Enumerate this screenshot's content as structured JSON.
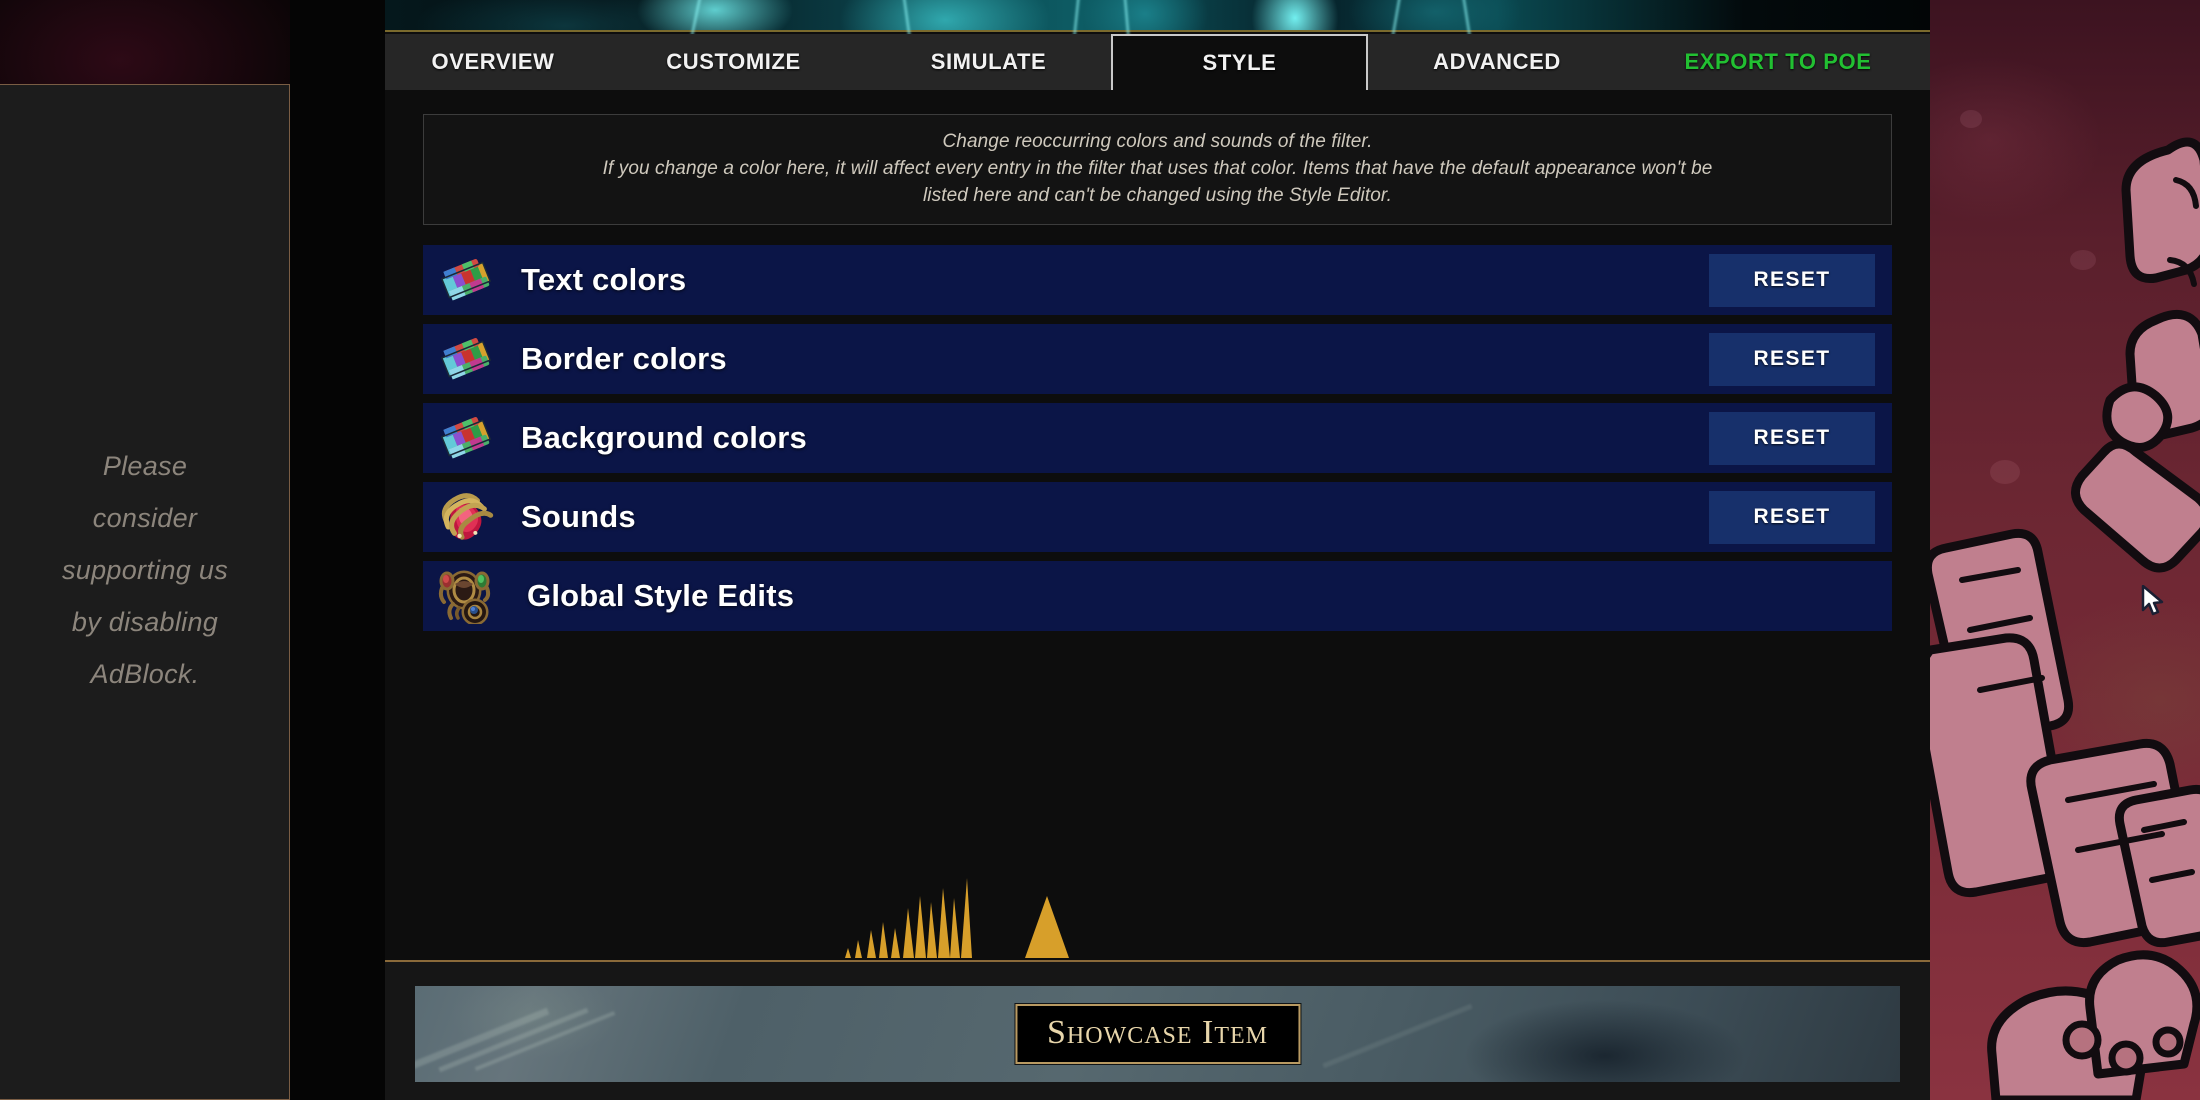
{
  "app": {
    "banner_alt": "filter-banner-art"
  },
  "tabs": [
    {
      "id": "overview",
      "label": "OVERVIEW",
      "active": false
    },
    {
      "id": "customize",
      "label": "CUSTOMIZE",
      "active": false
    },
    {
      "id": "simulate",
      "label": "SIMULATE",
      "active": false
    },
    {
      "id": "style",
      "label": "STYLE",
      "active": true
    },
    {
      "id": "advanced",
      "label": "ADVANCED",
      "active": false
    },
    {
      "id": "export",
      "label": "EXPORT TO POE",
      "active": false
    }
  ],
  "info": {
    "line1": "Change reoccurring colors and sounds of the filter.",
    "line2": "If you change a color here, it will affect every entry in the filter that uses that color. Items that have the default appearance won't be",
    "line3": "listed here and can't be changed using the Style Editor."
  },
  "style_rows": [
    {
      "id": "text-colors",
      "label": "Text colors",
      "icon": "chromatic-orb-icon",
      "reset_label": "RESET",
      "has_reset": true
    },
    {
      "id": "border-colors",
      "label": "Border colors",
      "icon": "chromatic-orb-icon",
      "reset_label": "RESET",
      "has_reset": true
    },
    {
      "id": "background-colors",
      "label": "Background colors",
      "icon": "chromatic-orb-icon",
      "reset_label": "RESET",
      "has_reset": true
    },
    {
      "id": "sounds",
      "label": "Sounds",
      "icon": "ruby-ring-icon",
      "reset_label": "RESET",
      "has_reset": true
    },
    {
      "id": "global-style-edits",
      "label": "Global Style Edits",
      "icon": "gemmed-amulet-icon",
      "reset_label": "",
      "has_reset": false
    }
  ],
  "showcase": {
    "item_label": "Showcase Item"
  },
  "adblock": {
    "line1": "Please",
    "line2": "consider",
    "line3": "supporting us",
    "line4": "by disabling",
    "line5": "AdBlock."
  },
  "colors": {
    "row_background": "#0b1547",
    "reset_button": "#17306b",
    "export_tab_text": "#22c032",
    "panel_background": "#0d0d0d",
    "tabbar_background": "#262626",
    "gold_border": "#8a6a3a",
    "showcase_text": "#e8d6ab"
  }
}
